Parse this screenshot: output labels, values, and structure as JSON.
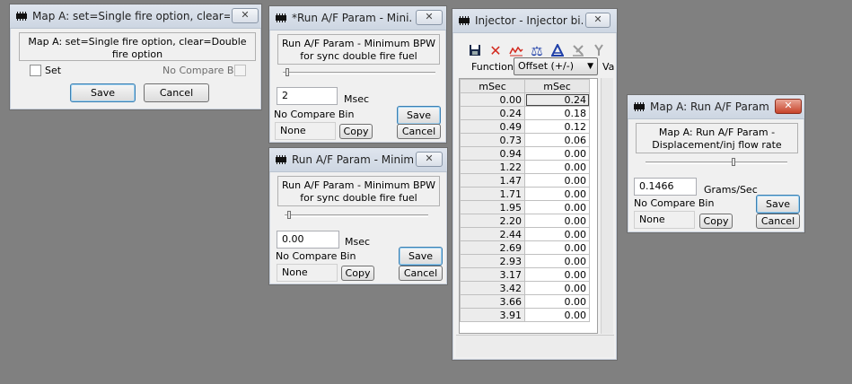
{
  "win1": {
    "title": "Map A: set=Single fire option, clear=Dou...",
    "description": "Map A: set=Single fire option, clear=Double fire option",
    "checkbox_label": "Set",
    "no_compare_label": "No Compare Bin",
    "save_label": "Save",
    "cancel_label": "Cancel"
  },
  "win2": {
    "title": "*Run A/F Param - Mini...",
    "description": "Run A/F Param - Minimum BPW for sync double fire fuel delivery (Upper Value)",
    "value": "2",
    "unit": "Msec",
    "no_compare_label": "No Compare Bin",
    "compare_value": "None",
    "save_label": "Save",
    "copy_label": "Copy",
    "cancel_label": "Cancel"
  },
  "win3": {
    "title": "Run A/F Param - Minim...",
    "description": "Run A/F Param - Minimum BPW for sync double fire fuel delivery (Min Value)",
    "value": "0.00",
    "unit": "Msec",
    "no_compare_label": "No Compare Bin",
    "compare_value": "None",
    "save_label": "Save",
    "copy_label": "Copy",
    "cancel_label": "Cancel"
  },
  "injector": {
    "title": "Injector - Injector bi...",
    "function_label": "Function:",
    "function_value": "Offset (+/-)",
    "function_trailing": "Va",
    "col_headers": [
      "mSec",
      "mSec"
    ],
    "rows": [
      [
        "0.00",
        "0.24"
      ],
      [
        "0.24",
        "0.18"
      ],
      [
        "0.49",
        "0.12"
      ],
      [
        "0.73",
        "0.06"
      ],
      [
        "0.94",
        "0.00"
      ],
      [
        "1.22",
        "0.00"
      ],
      [
        "1.47",
        "0.00"
      ],
      [
        "1.71",
        "0.00"
      ],
      [
        "1.95",
        "0.00"
      ],
      [
        "2.20",
        "0.00"
      ],
      [
        "2.44",
        "0.00"
      ],
      [
        "2.69",
        "0.00"
      ],
      [
        "2.93",
        "0.00"
      ],
      [
        "3.17",
        "0.00"
      ],
      [
        "3.42",
        "0.00"
      ],
      [
        "3.66",
        "0.00"
      ],
      [
        "3.91",
        "0.00"
      ]
    ]
  },
  "win5": {
    "title": "Map A: Run A/F Param ...",
    "description": "Map A: Run A/F Param - Displacement/inj flow rate (Lbs/Gram/sec)",
    "value": "0.1466",
    "unit": "Grams/Sec",
    "no_compare_label": "No Compare Bin",
    "compare_value": "None",
    "save_label": "Save",
    "copy_label": "Copy",
    "cancel_label": "Cancel"
  },
  "colors": {
    "desktop": "#808080",
    "window_bg": "#f0f0f0",
    "close_red": "#c7432a",
    "toolbar_red": "#d32a1f",
    "toolbar_blue": "#1f3fa8"
  }
}
